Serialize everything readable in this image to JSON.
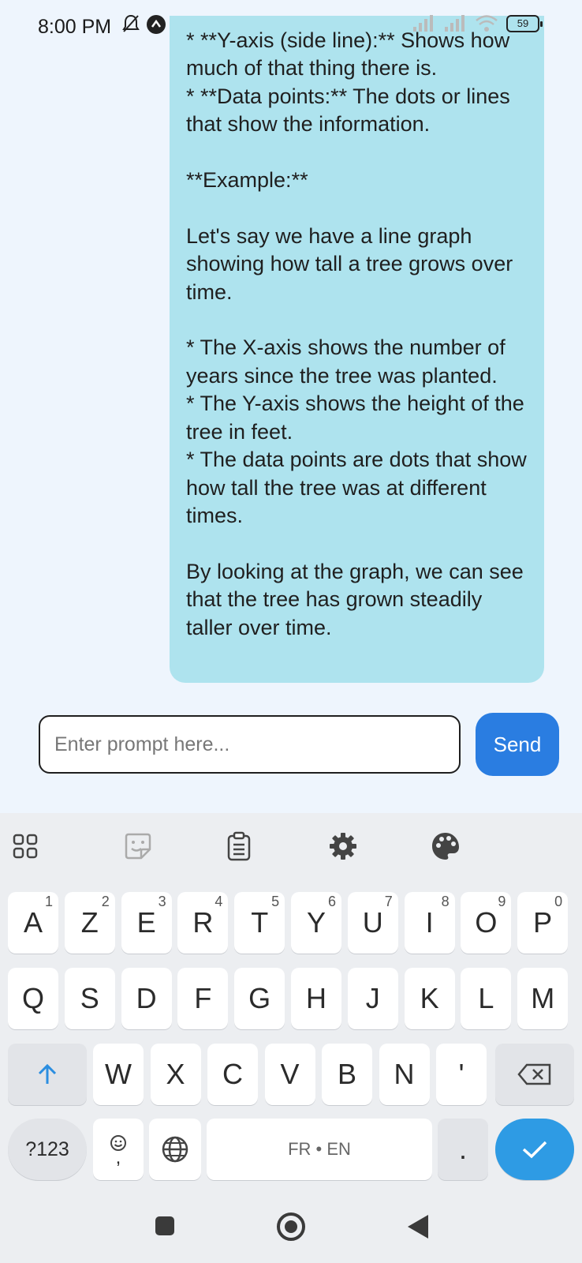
{
  "status_bar": {
    "time": "8:00 PM",
    "battery": "59"
  },
  "chat": {
    "message_text": "* **Y-axis (side line):** Shows how much of that thing there is.\n* **Data points:** The dots or lines that show the information.\n\n**Example:**\n\nLet's say we have a line graph showing how tall a tree grows over time.\n\n* The X-axis shows the number of years since the tree was planted.\n* The Y-axis shows the height of the tree in feet.\n* The data points are dots that show how tall the tree was at different times.\n\nBy looking at the graph, we can see that the tree has grown steadily taller over time."
  },
  "input": {
    "placeholder": "Enter prompt here...",
    "send_label": "Send"
  },
  "keyboard": {
    "toolbar_icons": [
      "apps-icon",
      "sticker-icon",
      "clipboard-icon",
      "settings-icon",
      "palette-icon"
    ],
    "row1": [
      {
        "label": "A",
        "hint": "1"
      },
      {
        "label": "Z",
        "hint": "2"
      },
      {
        "label": "E",
        "hint": "3"
      },
      {
        "label": "R",
        "hint": "4"
      },
      {
        "label": "T",
        "hint": "5"
      },
      {
        "label": "Y",
        "hint": "6"
      },
      {
        "label": "U",
        "hint": "7"
      },
      {
        "label": "I",
        "hint": "8"
      },
      {
        "label": "O",
        "hint": "9"
      },
      {
        "label": "P",
        "hint": "0"
      }
    ],
    "row2": [
      "Q",
      "S",
      "D",
      "F",
      "G",
      "H",
      "J",
      "K",
      "L",
      "M"
    ],
    "row3": [
      "W",
      "X",
      "C",
      "V",
      "B",
      "N",
      "'"
    ],
    "symbols_label": "?123",
    "emoji_comma": ",",
    "space_label": "FR • EN",
    "period": "."
  }
}
